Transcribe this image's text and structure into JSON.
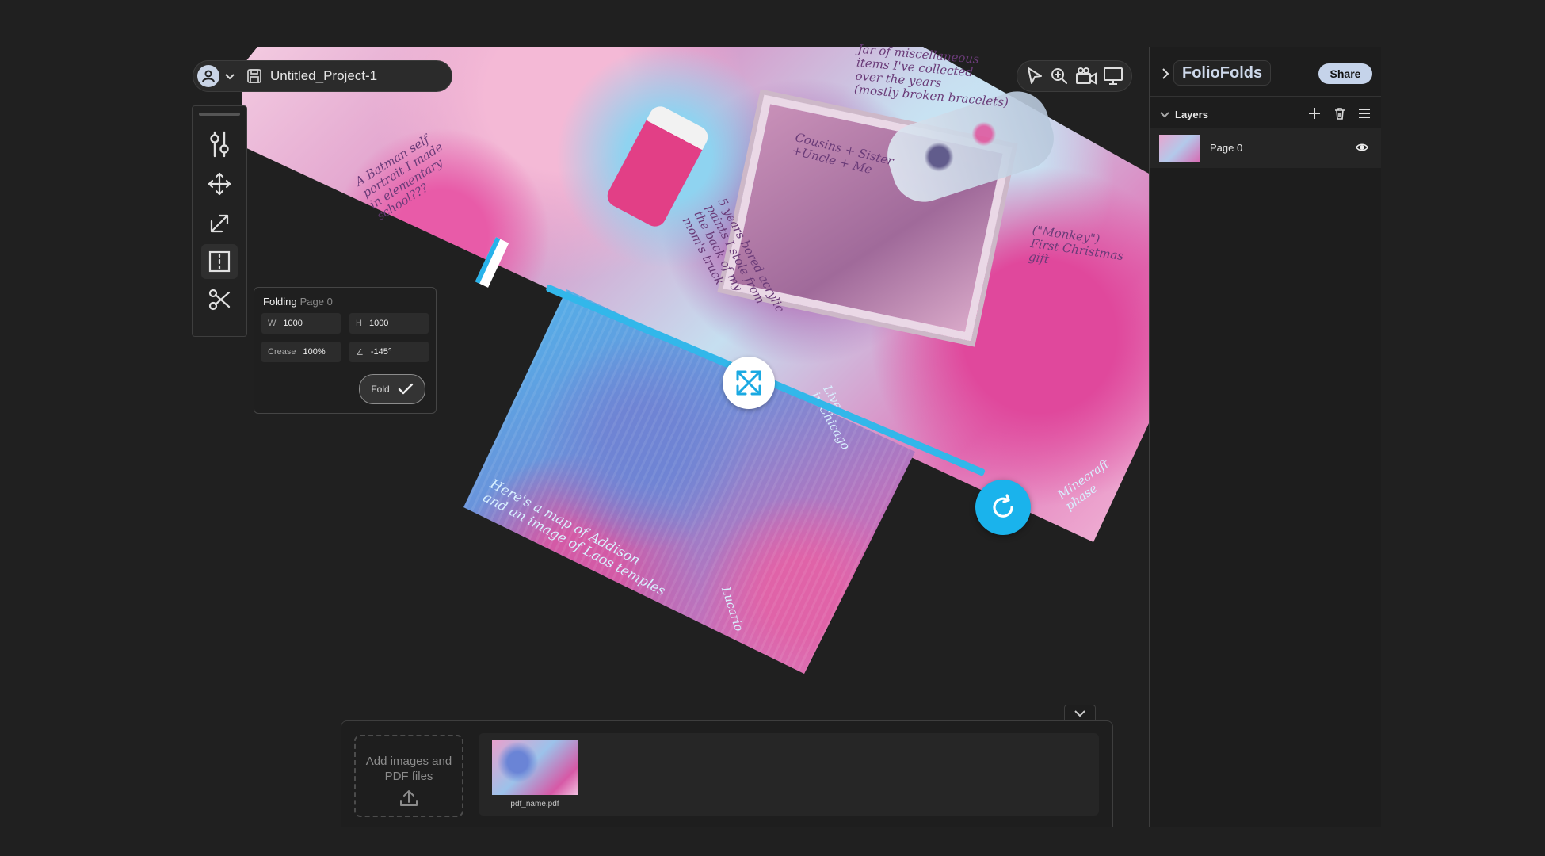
{
  "project": {
    "name": "Untitled_Project-1"
  },
  "canvas": {
    "annotations": [
      "A Batman self\nportrait I made\nin elementary\nschool???",
      "Jar of miscellaneous\nitems I've collected\nover the years\n(mostly broken bracelets)",
      "Cousins + Sister\n+Uncle + Me",
      "5 years bored acrylic\npaints I stole from\nthe back of my\nmom's truck",
      "(\"Monkey\")\nFirst Christmas\ngift",
      "Minecraft\nphase",
      "Here's a map of Addison\nand an image of Laos temples",
      "Lived\nin Chicago",
      "Lucario"
    ]
  },
  "toolbar": {
    "tools": [
      {
        "name": "adjust",
        "icon": "sliders-icon"
      },
      {
        "name": "move",
        "icon": "move-icon"
      },
      {
        "name": "scale",
        "icon": "resize-icon"
      },
      {
        "name": "fold",
        "icon": "fold-icon",
        "active": true
      },
      {
        "name": "cut",
        "icon": "scissors-icon"
      }
    ]
  },
  "folding": {
    "title": "Folding",
    "subtitle": "Page 0",
    "w_label": "W",
    "w_value": "1000",
    "h_label": "H",
    "h_value": "1000",
    "crease_label": "Crease",
    "crease_value": "100%",
    "angle_label": "∠",
    "angle_value": "-145°",
    "fold_button": "Fold"
  },
  "top_tools": [
    "pointer-icon",
    "zoom-icon",
    "camera-icon",
    "present-icon"
  ],
  "right_panel": {
    "brand": "FolioFolds",
    "share": "Share",
    "layers_label": "Layers",
    "layers": [
      {
        "name": "Page 0"
      }
    ]
  },
  "tray": {
    "add_text": "Add images and PDF files",
    "files": [
      {
        "name": "pdf_name.pdf"
      }
    ]
  },
  "colors": {
    "accent": "#1ab3ec",
    "share_bg": "#c5d3ea",
    "background": "#202020"
  }
}
